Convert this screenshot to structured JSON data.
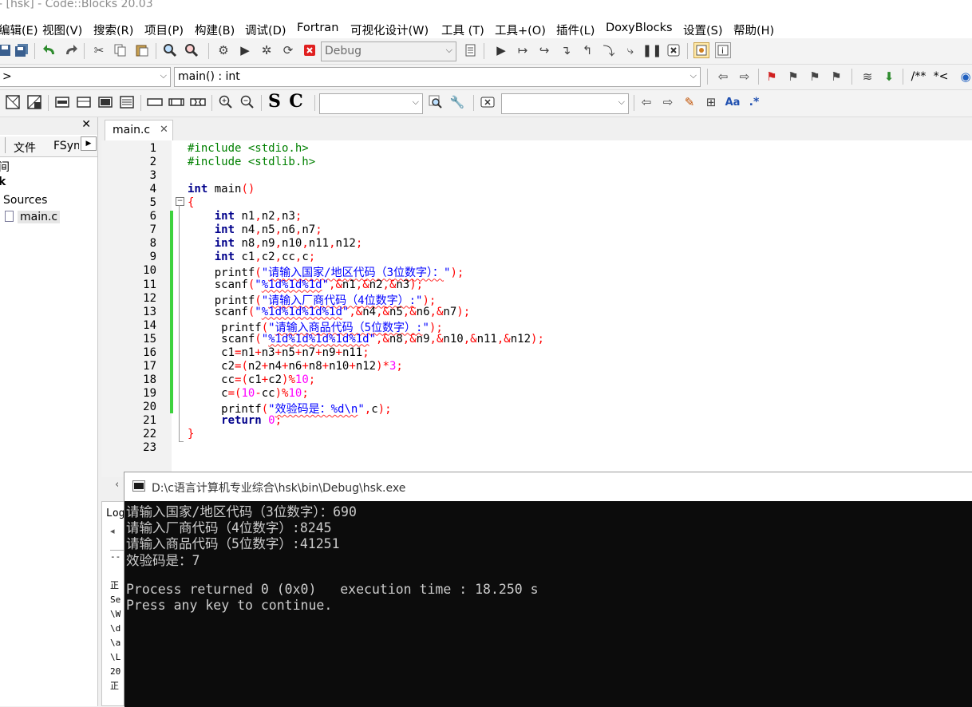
{
  "window": {
    "title": "- [hsk] - Code::Blocks 20.03"
  },
  "menu": [
    "编辑(E)",
    "视图(V)",
    "搜索(R)",
    "项目(P)",
    "构建(B)",
    "调试(D)",
    "Fortran",
    "可视化设计(W)",
    "工具 (T)",
    "工具+(O)",
    "插件(L)",
    "DoxyBlocks",
    "设置(S)",
    "帮助(H)"
  ],
  "toolbar": {
    "build_target": "Debug",
    "scope_combo": ">",
    "function_combo": "main() : int",
    "search_combo_1": "",
    "search_combo_2": "",
    "bold_s": "S",
    "bold_c": "C",
    "comment_block": "/**",
    "comment_line": "*<",
    "regex_btn": ".*"
  },
  "left_panel": {
    "tabs": [
      "文件",
      "FSym"
    ],
    "tree": [
      "间",
      "k",
      "Sources",
      "main.c"
    ]
  },
  "editor": {
    "active_tab": "main.c",
    "lines": [
      "#include <stdio.h>",
      "#include <stdlib.h>",
      "",
      "int main()",
      "{",
      "    int n1,n2,n3;",
      "    int n4,n5,n6,n7;",
      "    int n8,n9,n10,n11,n12;",
      "    int c1,c2,cc,c;",
      "    printf(\"请输入国家/地区代码（3位数字）：\");",
      "    scanf(\"%1d%1d%1d\",&n1,&n2,&n3);",
      "    printf(\"请输入厂商代码（4位数字）:\");",
      "    scanf(\"%1d%1d%1d%1d\",&n4,&n5,&n6,&n7);",
      "     printf(\"请输入商品代码（5位数字）:\");",
      "     scanf(\"%1d%1d%1d%1d%1d\",&n8,&n9,&n10,&n11,&n12);",
      "     c1=n1+n3+n5+n7+n9+n11;",
      "     c2=(n2+n4+n6+n8+n10+n12)*3;",
      "     cc=(c1+c2)%10;",
      "     c=(10-cc)%10;",
      "     printf(\"效验码是：%d\\n\",c);",
      "     return 0;",
      "}",
      ""
    ]
  },
  "log_panel": {
    "tab": "Log",
    "lines": [
      "--",
      "",
      "正",
      "Se",
      "\\W",
      "\\d",
      "\\a",
      "\\L",
      "20",
      "正"
    ]
  },
  "console": {
    "title": "D:\\c语言计算机专业综合\\hsk\\bin\\Debug\\hsk.exe",
    "lines": [
      "请输入国家/地区代码（3位数字）：690",
      "请输入厂商代码（4位数字）:8245",
      "请输入商品代码（5位数字）:41251",
      "效验码是：7",
      "",
      "Process returned 0 (0x0)   execution time : 18.250 s",
      "Press any key to continue."
    ]
  }
}
